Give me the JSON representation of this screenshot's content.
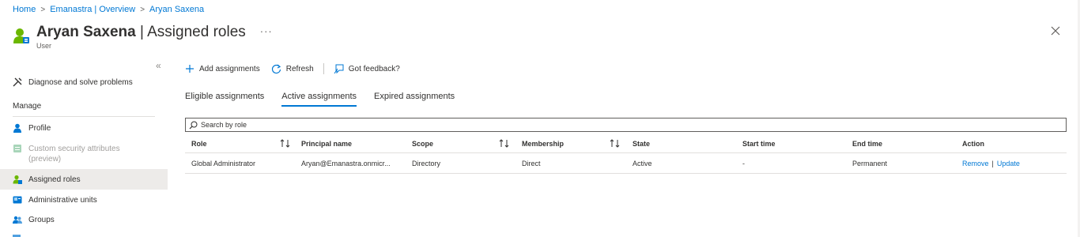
{
  "breadcrumb": {
    "items": [
      "Home",
      "Emanastra | Overview",
      "Aryan Saxena"
    ]
  },
  "header": {
    "title_name": "Aryan Saxena",
    "title_suffix": " | Assigned roles",
    "subtitle": "User",
    "more": "···"
  },
  "sidebar": {
    "diagnose": "Diagnose and solve problems",
    "manage_section": "Manage",
    "items": [
      "Profile",
      "Custom security attributes",
      "(preview)",
      "Assigned roles",
      "Administrative units",
      "Groups"
    ]
  },
  "toolbar": {
    "add": "Add assignments",
    "refresh": "Refresh",
    "feedback": "Got feedback?"
  },
  "tabs": [
    "Eligible assignments",
    "Active assignments",
    "Expired assignments"
  ],
  "search": {
    "placeholder": "Search by role"
  },
  "table": {
    "headers": [
      "Role",
      "Principal name",
      "Scope",
      "Membership",
      "State",
      "Start time",
      "End time",
      "Action"
    ],
    "rows": [
      {
        "role": "Global Administrator",
        "principal": "Aryan@Emanastra.onmicr...",
        "scope": "Directory",
        "membership": "Direct",
        "state": "Active",
        "start": "-",
        "end": "Permanent",
        "remove": "Remove",
        "update": "Update"
      }
    ]
  },
  "colors": {
    "accent": "#0078d4",
    "text": "#323130",
    "muted": "#605e5c",
    "green": "#6bb700"
  }
}
